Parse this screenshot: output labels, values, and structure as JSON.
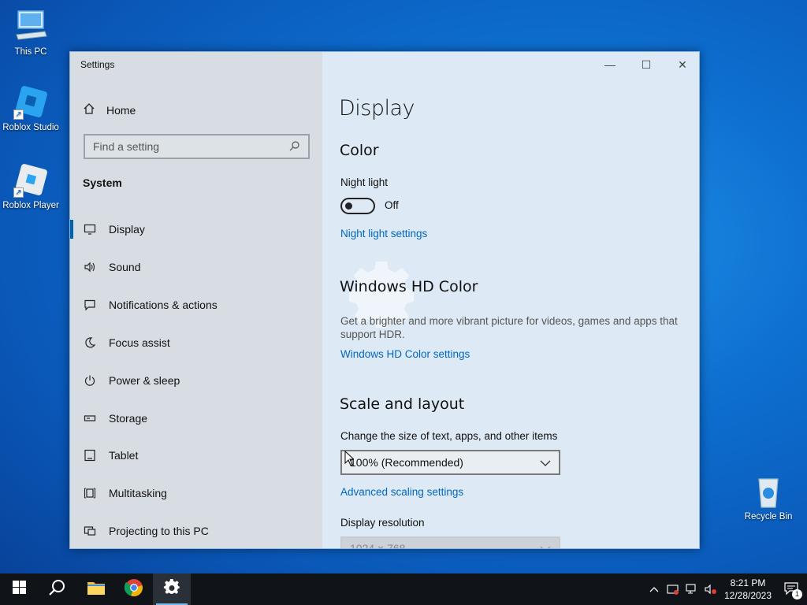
{
  "desktop": {
    "icons": [
      {
        "label": "This PC",
        "icon": "computer-icon"
      },
      {
        "label": "Roblox Studio",
        "icon": "roblox-studio-icon"
      },
      {
        "label": "Roblox Player",
        "icon": "roblox-player-icon"
      },
      {
        "label": "Recycle Bin",
        "icon": "recycle-bin-icon"
      }
    ]
  },
  "window": {
    "title": "Settings",
    "controls": {
      "minimize": "—",
      "maximize": "☐",
      "close": "✕"
    }
  },
  "sidebar": {
    "home_label": "Home",
    "search_placeholder": "Find a setting",
    "section_label": "System",
    "items": [
      {
        "label": "Display",
        "icon": "monitor-icon"
      },
      {
        "label": "Sound",
        "icon": "speaker-icon"
      },
      {
        "label": "Notifications & actions",
        "icon": "notification-icon"
      },
      {
        "label": "Focus assist",
        "icon": "moon-icon"
      },
      {
        "label": "Power & sleep",
        "icon": "power-icon"
      },
      {
        "label": "Storage",
        "icon": "storage-icon"
      },
      {
        "label": "Tablet",
        "icon": "tablet-icon"
      },
      {
        "label": "Multitasking",
        "icon": "multitasking-icon"
      },
      {
        "label": "Projecting to this PC",
        "icon": "projecting-icon"
      }
    ]
  },
  "main": {
    "page_title": "Display",
    "color": {
      "heading": "Color",
      "night_light_label": "Night light",
      "night_light_state": "Off",
      "night_light_link": "Night light settings"
    },
    "hd_color": {
      "heading": "Windows HD Color",
      "description": "Get a brighter and more vibrant picture for videos, games and apps that support HDR.",
      "link": "Windows HD Color settings"
    },
    "scale": {
      "heading": "Scale and layout",
      "size_label": "Change the size of text, apps, and other items",
      "size_value": "100% (Recommended)",
      "advanced_link": "Advanced scaling settings",
      "resolution_label": "Display resolution",
      "resolution_value": "1024 × 768"
    }
  },
  "taskbar": {
    "apps": [
      "start-icon",
      "search-icon",
      "file-explorer-icon",
      "chrome-icon",
      "settings-icon"
    ],
    "clock_time": "8:21 PM",
    "clock_date": "12/28/2023",
    "notification_count": "1"
  },
  "colors": {
    "accent": "#0063b1",
    "link": "#0067c0",
    "taskbar": "#101418"
  }
}
